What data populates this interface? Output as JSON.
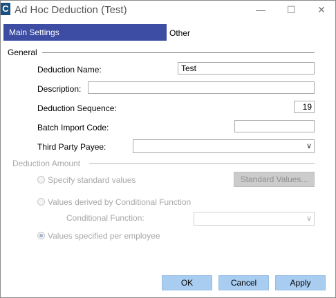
{
  "window": {
    "app_icon_letter": "C",
    "title": "Ad Hoc Deduction (Test)",
    "minimize_glyph": "—",
    "maximize_glyph": "☐",
    "close_glyph": "✕"
  },
  "tabs": {
    "main": "Main Settings",
    "other": "Other"
  },
  "general": {
    "heading": "General",
    "deduction_name_label": "Deduction Name:",
    "deduction_name_value": "Test",
    "description_label": "Description:",
    "description_value": "",
    "sequence_label": "Deduction Sequence:",
    "sequence_value": "19",
    "batch_import_label": "Batch Import Code:",
    "batch_import_value": "",
    "third_party_label": "Third Party Payee:",
    "third_party_value": ""
  },
  "deduction_amount": {
    "heading": "Deduction Amount",
    "opt_standard": "Specify standard values",
    "standard_values_button": "Standard Values...",
    "opt_conditional": "Values derived by Conditional Function",
    "conditional_function_label": "Conditional Function:",
    "conditional_function_value": "",
    "opt_per_employee": "Values specified per employee",
    "selected_option": "per_employee"
  },
  "buttons": {
    "ok": "OK",
    "cancel": "Cancel",
    "apply": "Apply"
  }
}
